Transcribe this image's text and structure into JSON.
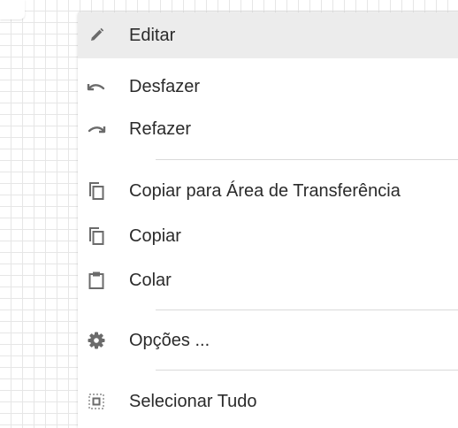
{
  "menu": {
    "items": [
      {
        "label": "Editar",
        "icon": "pencil-icon"
      },
      {
        "label": "Desfazer",
        "icon": "undo-icon"
      },
      {
        "label": "Refazer",
        "icon": "redo-icon"
      },
      {
        "label": "Copiar para Área de Transferência",
        "icon": "copy-icon"
      },
      {
        "label": "Copiar",
        "icon": "copy-icon"
      },
      {
        "label": "Colar",
        "icon": "clipboard-icon"
      },
      {
        "label": "Opções ...",
        "icon": "gear-icon"
      },
      {
        "label": "Selecionar Tudo",
        "icon": "select-all-icon"
      }
    ]
  },
  "colors": {
    "hover_background": "#ececec",
    "icon": "#6b6b6b",
    "text": "#2b2b2b",
    "grid": "#e6e6e6"
  }
}
